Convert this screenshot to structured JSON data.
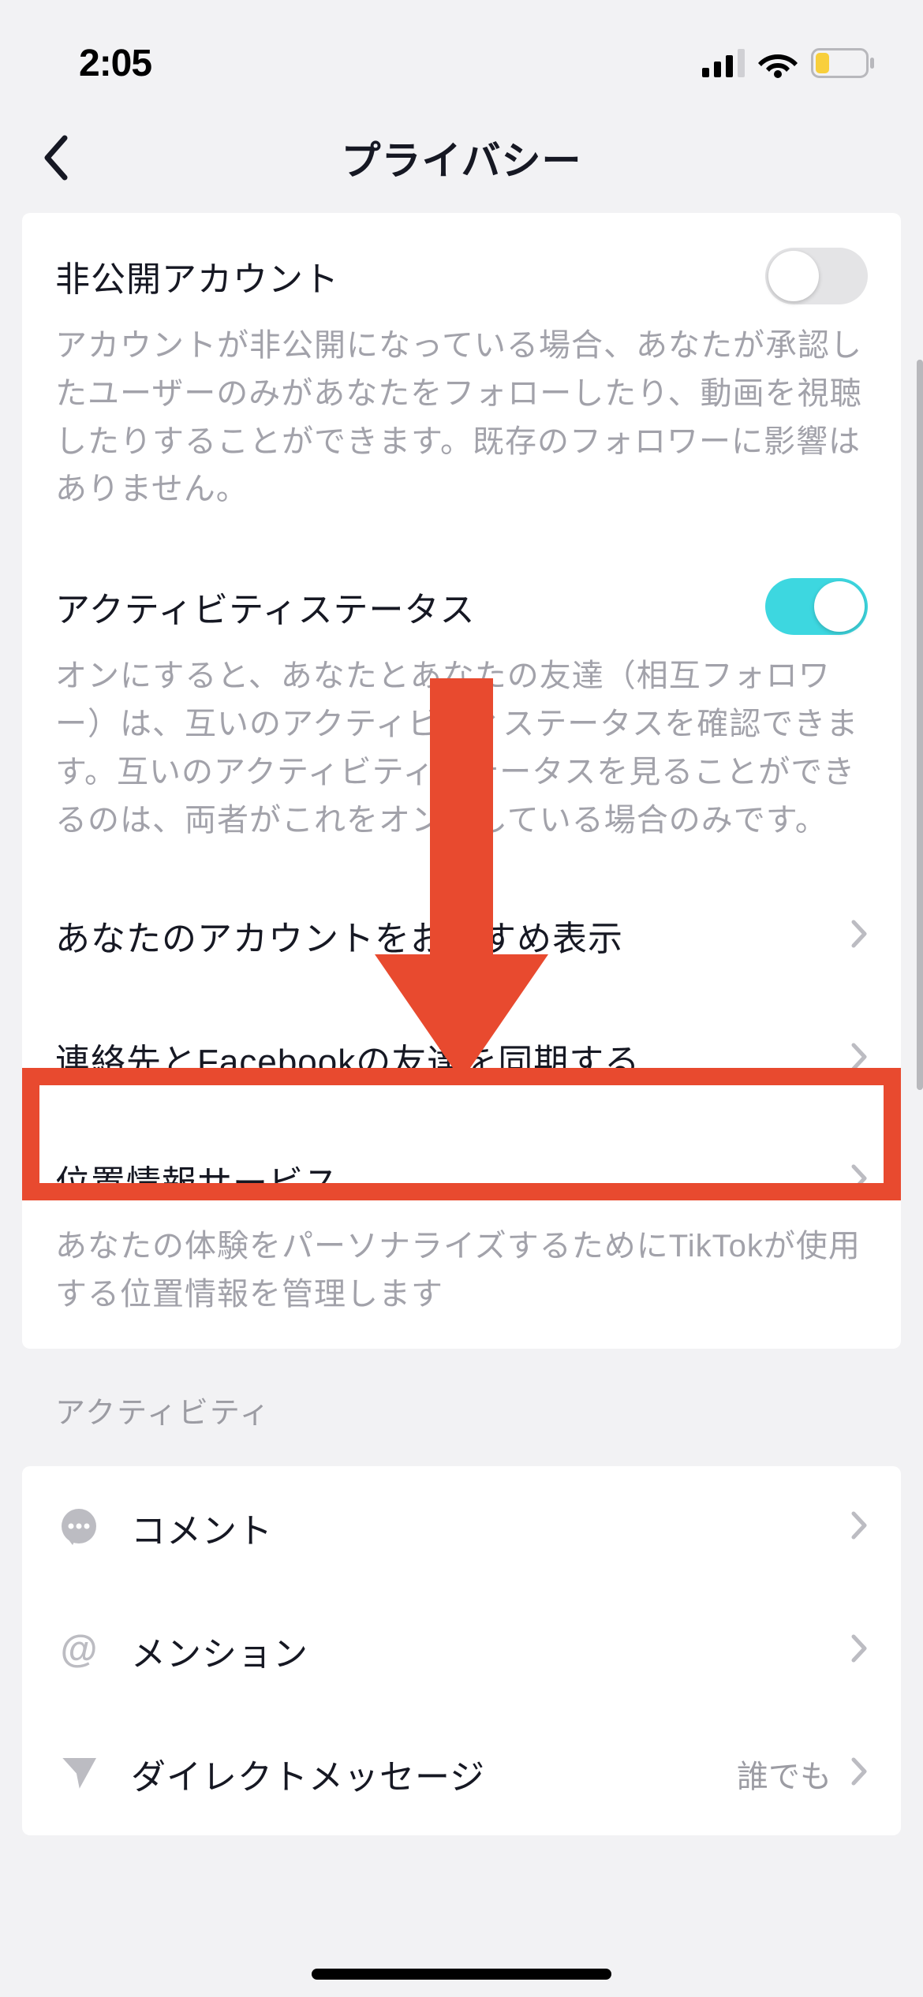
{
  "status": {
    "time": "2:05"
  },
  "header": {
    "title": "プライバシー"
  },
  "privacy": {
    "private_account": {
      "label": "非公開アカウント",
      "desc": "アカウントが非公開になっている場合、あなたが承認したユーザーのみがあなたをフォローしたり、動画を視聴したりすることができます。既存のフォロワーに影響はありません。",
      "enabled": false
    },
    "activity_status": {
      "label": "アクティビティステータス",
      "desc": "オンにすると、あなたとあなたの友達（相互フォロワー）は、互いのアクティビティステータスを確認できます。互いのアクティビティステータスを見ることができるのは、両者がこれをオンにしている場合のみです。",
      "enabled": true
    },
    "suggest_account": {
      "label": "あなたのアカウントをおすすめ表示"
    },
    "sync_contacts": {
      "label": "連絡先とFacebookの友達を同期する"
    },
    "location": {
      "label": "位置情報サービス",
      "desc": "あなたの体験をパーソナライズするためにTikTokが使用する位置情報を管理します"
    }
  },
  "sections": {
    "activity": "アクティビティ"
  },
  "activity": {
    "items": [
      {
        "icon": "comment",
        "label": "コメント",
        "value": ""
      },
      {
        "icon": "mention",
        "label": "メンション",
        "value": ""
      },
      {
        "icon": "dm",
        "label": "ダイレクトメッセージ",
        "value": "誰でも"
      }
    ]
  },
  "colors": {
    "accent_toggle": "#3dd7e0",
    "annotation": "#e84a2f",
    "battery_fill": "#f8cf3c"
  }
}
